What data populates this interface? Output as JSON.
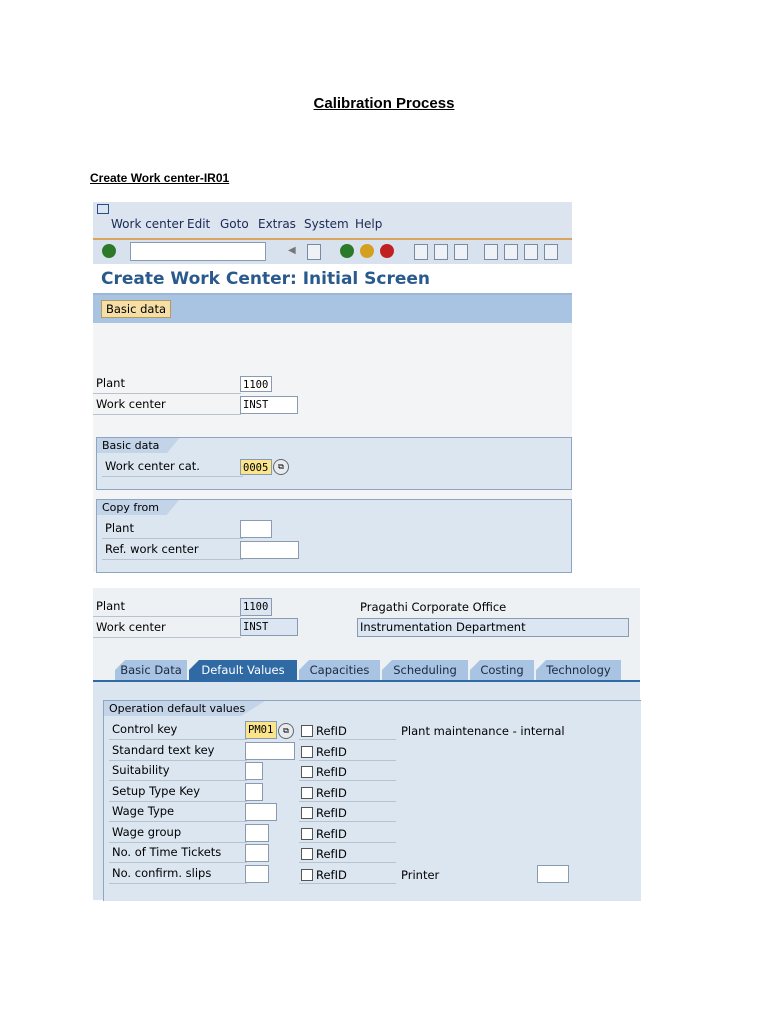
{
  "document": {
    "title": "Calibration Process",
    "subtitle": "Create Work center-IR01"
  },
  "screen1": {
    "menu": [
      "Work center",
      "Edit",
      "Goto",
      "Extras",
      "System",
      "Help"
    ],
    "command_field": "",
    "title": "Create Work Center: Initial Screen",
    "app_button": "Basic data",
    "fields": {
      "plant_label": "Plant",
      "plant_value": "1100",
      "work_center_label": "Work center",
      "work_center_value": "INST"
    },
    "basic_group": {
      "title": "Basic data",
      "cat_label": "Work center cat.",
      "cat_value": "0005"
    },
    "copy_group": {
      "title": "Copy from",
      "plant_label": "Plant",
      "plant_value": "",
      "ref_label": "Ref. work center",
      "ref_value": ""
    }
  },
  "screen2": {
    "plant_label": "Plant",
    "plant_value": "1100",
    "plant_desc": "Pragathi Corporate Office",
    "work_center_label": "Work center",
    "work_center_value": "INST",
    "work_center_desc": "Instrumentation Department",
    "tabs": [
      "Basic Data",
      "Default Values",
      "Capacities",
      "Scheduling",
      "Costing",
      "Technology"
    ],
    "active_tab": "Default Values",
    "group_title": "Operation default values",
    "refid_label": "RefID",
    "rows": [
      {
        "label": "Control key",
        "value": "PM01",
        "desc": "Plant maintenance - internal"
      },
      {
        "label": "Standard text key",
        "value": ""
      },
      {
        "label": "Suitability",
        "value": ""
      },
      {
        "label": "Setup Type Key",
        "value": ""
      },
      {
        "label": "Wage Type",
        "value": ""
      },
      {
        "label": "Wage group",
        "value": ""
      },
      {
        "label": "No. of Time Tickets",
        "value": ""
      },
      {
        "label": "No. confirm. slips",
        "value": ""
      }
    ],
    "printer_label": "Printer",
    "printer_value": ""
  }
}
